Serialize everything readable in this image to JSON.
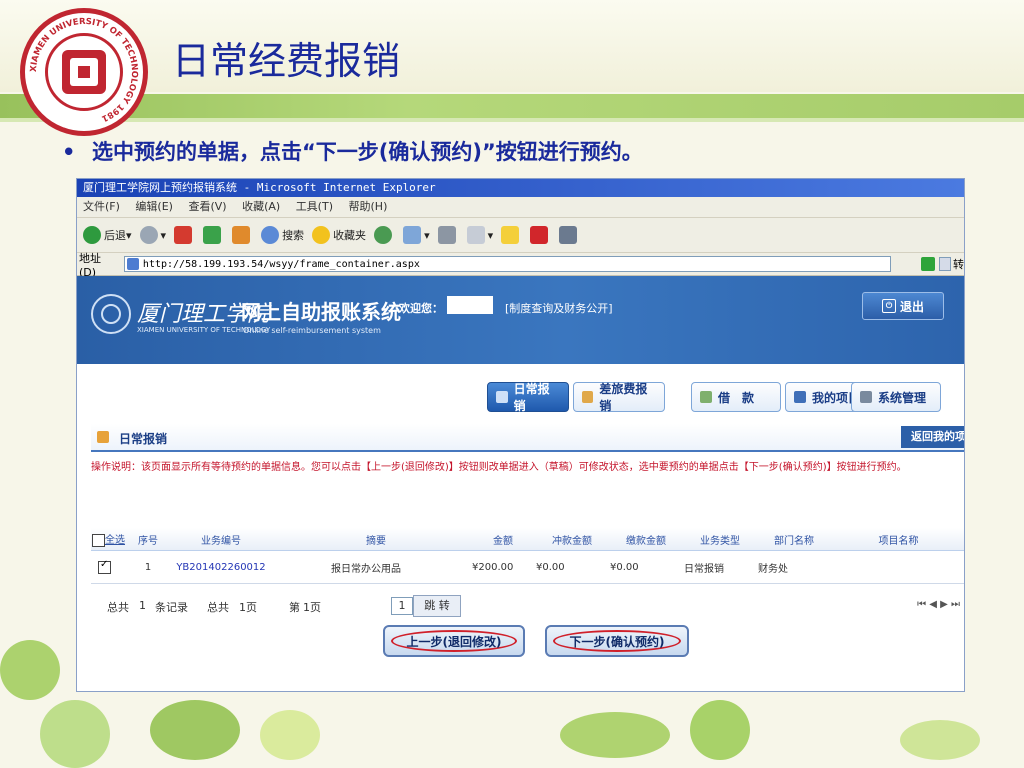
{
  "slide": {
    "title": "日常经费报销",
    "bullet": "选中预约的单据，点击“下一步(确认预约)”按钮进行预约。",
    "logo_text": "XIAMEN UNIVERSITY OF TECHNOLOGY 1981"
  },
  "browser": {
    "title": "厦门理工学院网上预约报销系统 - Microsoft Internet Explorer",
    "menu": [
      "文件(F)",
      "编辑(E)",
      "查看(V)",
      "收藏(A)",
      "工具(T)",
      "帮助(H)"
    ],
    "toolbar": {
      "back": "后退",
      "search": "搜索",
      "favorites": "收藏夹"
    },
    "address_label": "地址(D)",
    "address": "http://58.199.193.54/wsyy/frame_container.aspx",
    "go_label": "转"
  },
  "app": {
    "university_name": "厦门理工学院",
    "university_en": "XIAMEN UNIVERSITY OF TECHNOLOGY",
    "system_name": "网上自助报账系统",
    "system_en": "Online self-reimbursement system",
    "welcome": "欢迎您：",
    "notice_link": "[制度查询及财务公开]",
    "logout": "退出"
  },
  "nav": {
    "tabs": [
      {
        "label": "日常报销",
        "active": true
      },
      {
        "label": "差旅费报销",
        "active": false
      },
      {
        "label": "借　款",
        "active": false
      },
      {
        "label": "我的项目",
        "active": false
      },
      {
        "label": "系统管理",
        "active": false
      }
    ]
  },
  "panel": {
    "title": "日常报销",
    "back_button": "返回我的项",
    "instruction": "操作说明：该页面显示所有等待预约的单据信息。您可以点击【上一步(退回修改)】按钮则改单据进入（草稿）可修改状态，选中要预约的单据点击【下一步(确认预约)】按钮进行预约。"
  },
  "table": {
    "select_all": "全选",
    "columns": [
      "序号",
      "业务编号",
      "摘要",
      "金额",
      "冲款金额",
      "缴款金额",
      "业务类型",
      "部门名称",
      "项目名称"
    ],
    "rows": [
      {
        "checked": true,
        "index": "1",
        "business_no": "YB201402260012",
        "summary": "报日常办公用品",
        "amount": "¥200.00",
        "offset_amount": "¥0.00",
        "payment_amount": "¥0.00",
        "type": "日常报销",
        "department": "财务处",
        "project": ""
      }
    ]
  },
  "pager": {
    "total_label": "总共",
    "total_records": "1",
    "records_unit": "条记录",
    "total_pages_label": "总共",
    "total_pages": "1页",
    "current_label": "第",
    "current_page": "1页",
    "page_input": "1",
    "jump": "跳 转",
    "arrows": "⏮ ◀ ▶ ⏭"
  },
  "actions": {
    "prev": "上一步(退回修改)",
    "next": "下一步(确认预约)"
  },
  "colors": {
    "title_blue": "#1a2a9c",
    "header_blue": "#2a5fa6",
    "instruction_red": "#c4142b",
    "highlight_ring": "#d0202a"
  }
}
